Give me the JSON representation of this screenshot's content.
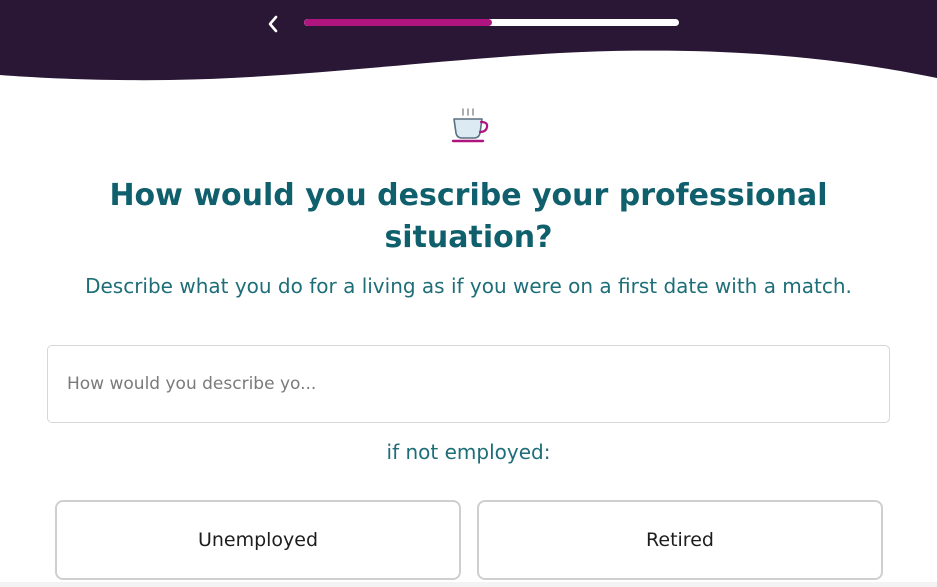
{
  "header": {
    "back_icon": "chevron-left-icon",
    "progress_fraction": 0.5,
    "colors": {
      "background": "#2a1736",
      "progress_fill": "#b0147f",
      "progress_track": "#ffffff"
    }
  },
  "question": {
    "icon": "coffee-cup-icon",
    "title": "How would you describe your professional situation?",
    "subtitle": "Describe what you do for a living as if you were on a first date with a match."
  },
  "answer": {
    "value": "",
    "placeholder": "How would you describe yo..."
  },
  "fallback": {
    "label": "if not employed:",
    "options": [
      {
        "label": "Unemployed"
      },
      {
        "label": "Retired"
      }
    ]
  },
  "colors": {
    "heading": "#0f5f6c",
    "accent": "#b0147f"
  }
}
